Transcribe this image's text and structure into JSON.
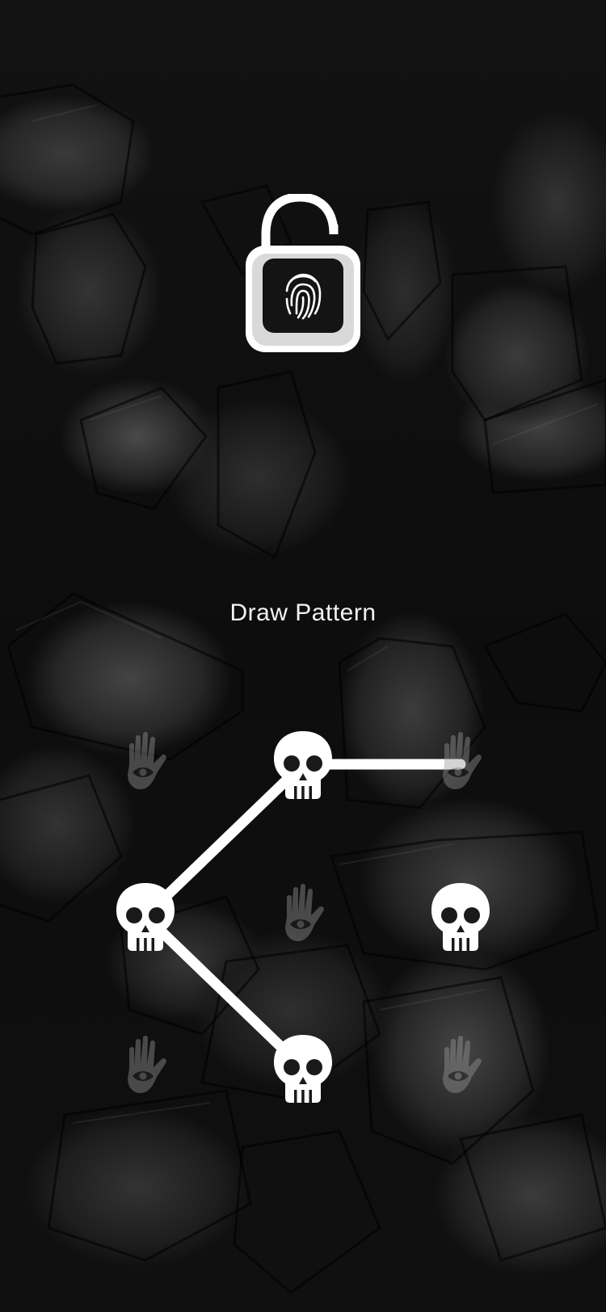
{
  "screen": {
    "background": "dark-rock-wallpaper",
    "lock_icon": "unlocked-padlock-fingerprint-icon"
  },
  "prompt": {
    "title": "Draw Pattern"
  },
  "pattern": {
    "grid": [
      {
        "row": 1,
        "col": 1,
        "icon": "eye-hand-icon",
        "selected": false
      },
      {
        "row": 1,
        "col": 2,
        "icon": "skull-icon",
        "selected": true
      },
      {
        "row": 1,
        "col": 3,
        "icon": "eye-hand-icon",
        "selected": false
      },
      {
        "row": 2,
        "col": 1,
        "icon": "skull-icon",
        "selected": true
      },
      {
        "row": 2,
        "col": 2,
        "icon": "eye-hand-icon",
        "selected": false
      },
      {
        "row": 2,
        "col": 3,
        "icon": "skull-icon",
        "selected": true
      },
      {
        "row": 3,
        "col": 1,
        "icon": "eye-hand-icon",
        "selected": false
      },
      {
        "row": 3,
        "col": 2,
        "icon": "skull-icon",
        "selected": true
      },
      {
        "row": 3,
        "col": 3,
        "icon": "eye-hand-icon",
        "selected": false
      }
    ],
    "connections": [
      [
        2,
        3
      ],
      [
        2,
        4
      ],
      [
        4,
        8
      ]
    ],
    "colors": {
      "line": "#ffffff",
      "selected": "#ffffff",
      "unselected": "#9a9a9a"
    }
  }
}
